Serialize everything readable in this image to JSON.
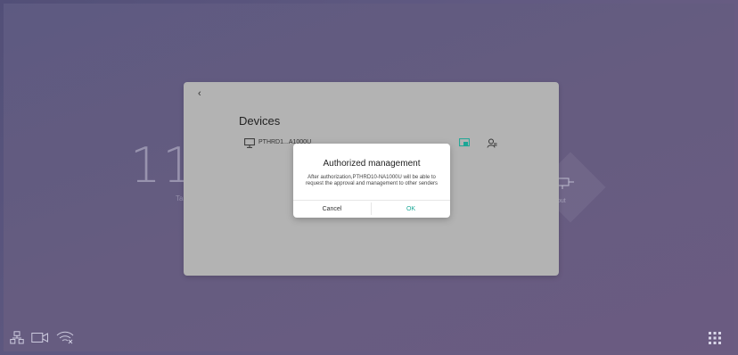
{
  "background": {
    "clock_text": "11",
    "clock_sub": "Ta",
    "tile_label": "out"
  },
  "panel": {
    "back_label": "‹",
    "title": "Devices",
    "device": {
      "name": "PTHRD1...A1000U",
      "icon": "monitor-icon"
    },
    "actions": {
      "cast_icon": "cast-icon",
      "user_icon": "user-manage-icon"
    }
  },
  "dialog": {
    "title": "Authorized management",
    "message": "After authorization,PTHRD10-NA1000U will be able to request the approval and management to other senders",
    "cancel_label": "Cancel",
    "ok_label": "OK"
  },
  "statusbar": {
    "icons": [
      "network-icon",
      "camera-icon",
      "wifi-off-icon"
    ]
  },
  "colors": {
    "accent": "#1aa796",
    "panel": "#b3b3b3",
    "background": "#6e6792"
  }
}
